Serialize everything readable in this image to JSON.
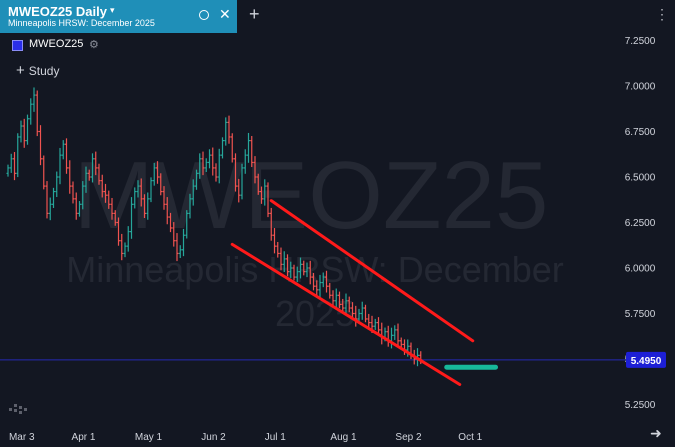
{
  "tab": {
    "title": "MWEOZ25 Daily",
    "subtitle": "Minneapolis HRSW: December 2025",
    "caret": "▾",
    "close_glyph": "✕"
  },
  "new_tab_glyph": "+",
  "menu_glyph": "⋮",
  "legend": {
    "symbol": "MWEOZ25",
    "settings_icon": "gear-icon"
  },
  "study": {
    "label": "Study",
    "plus_glyph": "+"
  },
  "watermark": {
    "line1": "MWEOZ25",
    "line2": "Minneapolis HRSW: December",
    "line3": "2025"
  },
  "scroll_arrow_glyph": "➜",
  "colors": {
    "background": "#131722",
    "tab": "#1f8fb8",
    "up": "#26a69a",
    "down": "#ef5350",
    "channel": "#ff1a1a",
    "support": "#17b89a",
    "price_badge": "#1d1fd6"
  },
  "chart_data": {
    "type": "ohlc",
    "title": "MWEOZ25 Daily",
    "subtitle": "Minneapolis HRSW: December 2025",
    "y_ticks": [
      7.25,
      7.0,
      6.75,
      6.5,
      6.25,
      6.0,
      5.75,
      5.5,
      5.25
    ],
    "y_tick_labels": [
      "7.2500",
      "7.0000",
      "6.7500",
      "6.5000",
      "6.2500",
      "6.0000",
      "5.7500",
      "5.4950",
      "5.2500"
    ],
    "ylim": [
      5.14,
      7.3
    ],
    "x_ticks": [
      "Mar 3",
      "Apr 1",
      "May 1",
      "Jun 2",
      "Jul 1",
      "Aug 1",
      "Sep 2",
      "Oct 1"
    ],
    "x_tick_positions": [
      3,
      22,
      42,
      62,
      81,
      102,
      122,
      141
    ],
    "last_price": 5.495,
    "last_price_label": "5.4950",
    "series_closes": [
      6.55,
      6.6,
      6.52,
      6.72,
      6.78,
      6.7,
      6.82,
      6.9,
      6.95,
      6.75,
      6.6,
      6.45,
      6.3,
      6.35,
      6.42,
      6.5,
      6.62,
      6.68,
      6.55,
      6.45,
      6.38,
      6.3,
      6.35,
      6.45,
      6.52,
      6.5,
      6.6,
      6.55,
      6.48,
      6.42,
      6.4,
      6.35,
      6.3,
      6.25,
      6.15,
      6.08,
      6.12,
      6.2,
      6.35,
      6.42,
      6.45,
      6.38,
      6.3,
      6.38,
      6.48,
      6.55,
      6.5,
      6.42,
      6.35,
      6.28,
      6.22,
      6.15,
      6.08,
      6.1,
      6.18,
      6.3,
      6.38,
      6.45,
      6.52,
      6.6,
      6.55,
      6.58,
      6.62,
      6.55,
      6.5,
      6.62,
      6.7,
      6.8,
      6.72,
      6.6,
      6.45,
      6.4,
      6.55,
      6.62,
      6.7,
      6.58,
      6.5,
      6.42,
      6.38,
      6.45,
      6.3,
      6.18,
      6.12,
      6.08,
      6.02,
      6.05,
      5.98,
      6.0,
      5.95,
      5.98,
      6.02,
      5.98,
      6.0,
      5.95,
      5.9,
      5.88,
      5.92,
      5.95,
      5.9,
      5.85,
      5.82,
      5.85,
      5.8,
      5.78,
      5.82,
      5.78,
      5.75,
      5.72,
      5.75,
      5.78,
      5.72,
      5.7,
      5.68,
      5.7,
      5.66,
      5.62,
      5.65,
      5.6,
      5.63,
      5.66,
      5.6,
      5.58,
      5.55,
      5.57,
      5.52,
      5.5,
      5.52,
      5.495
    ],
    "annotations": [
      {
        "type": "trendline",
        "from": [
          81,
          6.37
        ],
        "to": [
          143,
          5.6
        ]
      },
      {
        "type": "trendline",
        "from": [
          69,
          6.13
        ],
        "to": [
          139,
          5.36
        ]
      },
      {
        "type": "horizontal_segment",
        "from": [
          135,
          5.455
        ],
        "to": [
          150,
          5.455
        ]
      }
    ]
  }
}
